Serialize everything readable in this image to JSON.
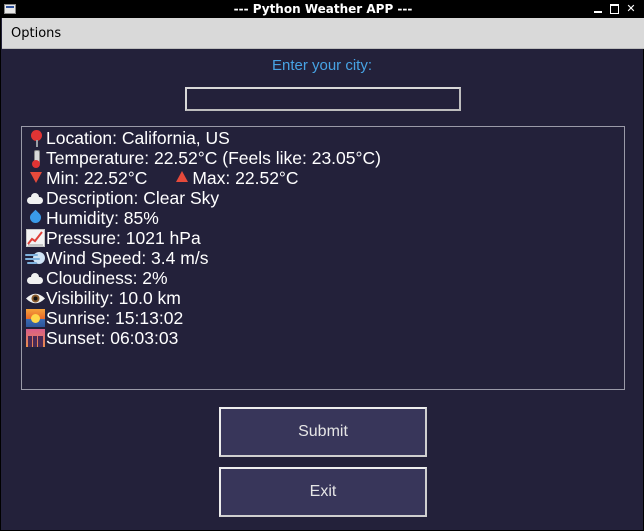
{
  "window": {
    "title": "--- Python Weather APP ---",
    "minimize_glyph": "",
    "maximize_glyph": "",
    "close_glyph": "✕"
  },
  "menu": {
    "options_label": "Options"
  },
  "form": {
    "prompt": "Enter your city:",
    "city_value": "",
    "city_placeholder": ""
  },
  "weather": {
    "location": "Location: California, US",
    "temperature": "Temperature: 22.52°C (Feels like: 23.05°C)",
    "min": "Min: 22.52°C",
    "max": "Max: 22.52°C",
    "description": "Description: Clear Sky",
    "humidity": "Humidity: 85%",
    "pressure": "Pressure: 1021 hPa",
    "wind": "Wind Speed: 3.4 m/s",
    "cloudiness": "Cloudiness: 2%",
    "visibility": "Visibility: 10.0 km",
    "sunrise": "Sunrise: 15:13:02",
    "sunset": "Sunset: 06:03:03"
  },
  "icons": {
    "location": "round-pushpin-icon",
    "temperature": "thermometer-icon",
    "min": "red-triangle-down-icon",
    "max": "red-triangle-up-icon",
    "description": "cloud-icon",
    "humidity": "droplet-icon",
    "pressure": "chart-increasing-icon",
    "wind": "dashing-away-icon",
    "cloudiness": "cloud-icon",
    "visibility": "eye-icon",
    "sunrise": "sunrise-icon",
    "sunset": "city-sunset-icon"
  },
  "buttons": {
    "submit_label": "Submit",
    "exit_label": "Exit"
  },
  "colors": {
    "window_background": "#23213a",
    "button_background": "#38365a",
    "prompt_text": "#47a3e4",
    "menubar_background": "#d9d9d9"
  }
}
